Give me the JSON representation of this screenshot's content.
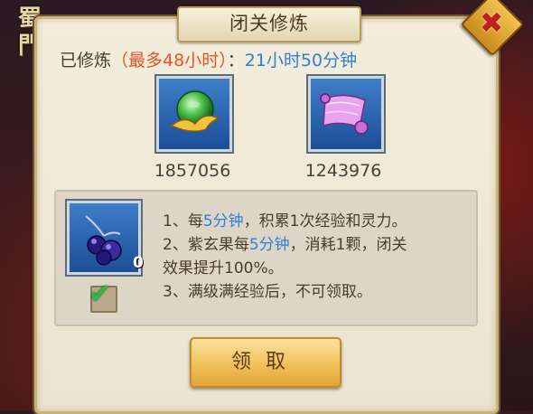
{
  "logo": {
    "text_line1": "蜀",
    "text_line2": "門"
  },
  "dialog": {
    "title": "闭关修炼",
    "close_label": "✖"
  },
  "status": {
    "prefix": "已修炼",
    "limit": "（最多48小时）",
    "separator": "：",
    "time": "21小时50分钟"
  },
  "rewards": [
    {
      "icon": "green-jade-orb-icon",
      "value": "1857056"
    },
    {
      "icon": "purple-scroll-icon",
      "value": "1243976"
    }
  ],
  "rules_panel": {
    "item": {
      "icon": "purple-fruit-icon",
      "count": "0"
    },
    "checkbox_checked": true,
    "lines": [
      {
        "a": "1、每",
        "b": "5分钟",
        "c": "，积累1次经验和灵力。"
      },
      {
        "a": "2、紫玄果每",
        "b": "5分钟",
        "c": "，消耗1颗，闭关"
      },
      {
        "a": "效果提升100%。",
        "b": "",
        "c": ""
      },
      {
        "a": "3、满级满经验后，不可领取。",
        "b": "",
        "c": ""
      }
    ]
  },
  "claim_button": {
    "label": "领取"
  },
  "colors": {
    "accent_blue": "#2f7fd8",
    "accent_red": "#e8542a",
    "button_gold": "#f1c05a"
  }
}
